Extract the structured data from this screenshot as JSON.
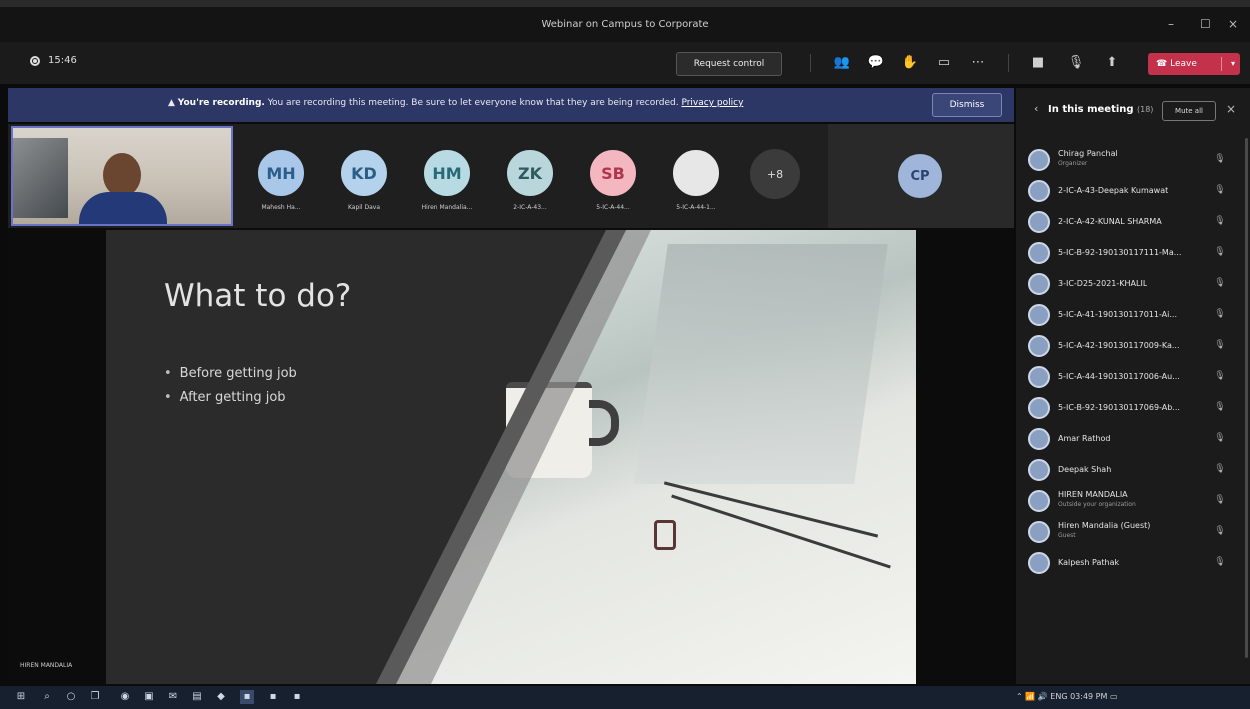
{
  "window": {
    "title": "Webinar on Campus to Corporate"
  },
  "toolbar": {
    "timer": "15:46",
    "request_control": "Request control",
    "leave": "Leave"
  },
  "banner": {
    "bold": "You're recording.",
    "text": "You are recording this meeting. Be sure to let everyone know that they are being recorded.",
    "link": "Privacy policy",
    "dismiss": "Dismiss"
  },
  "strip": {
    "tiles": [
      {
        "initials": "MH",
        "name": "Mahesh Ha...",
        "bg": "#a9c7e8",
        "fg": "#2d5d8c"
      },
      {
        "initials": "KD",
        "name": "Kapil Dava",
        "bg": "#b4d2ec",
        "fg": "#2b5e86"
      },
      {
        "initials": "HM",
        "name": "Hiren Mandalia...",
        "bg": "#b8dbe3",
        "fg": "#2a6a78"
      },
      {
        "initials": "ZK",
        "name": "2-IC-A-43...",
        "bg": "#b9d6db",
        "fg": "#2e5a60"
      },
      {
        "initials": "SB",
        "name": "5-IC-A-44...",
        "bg": "#f4b6bf",
        "fg": "#b0364b"
      },
      {
        "initials": "",
        "name": "5-IC-A-44-1...",
        "bg": "#e7e7e7",
        "fg": "#222"
      }
    ],
    "more": "+8",
    "cp": "CP"
  },
  "slide": {
    "title": "What to do?",
    "bullets": [
      "Before getting job",
      "After getting job"
    ],
    "presenter": "HIREN MANDALIA"
  },
  "panel": {
    "title": "In this meeting",
    "count": "(18)",
    "mute_all": "Mute all",
    "participants": [
      {
        "name": "Chirag Panchal",
        "role": "Organizer"
      },
      {
        "name": "2-IC-A-43-Deepak Kumawat",
        "role": ""
      },
      {
        "name": "2-IC-A-42-KUNAL SHARMA",
        "role": ""
      },
      {
        "name": "5-IC-B-92-190130117111-Ma...",
        "role": ""
      },
      {
        "name": "3-IC-D25-2021-KHALIL",
        "role": ""
      },
      {
        "name": "5-IC-A-41-190130117011-Ai...",
        "role": ""
      },
      {
        "name": "5-IC-A-42-190130117009-Ka...",
        "role": ""
      },
      {
        "name": "5-IC-A-44-190130117006-Au...",
        "role": ""
      },
      {
        "name": "5-IC-B-92-190130117069-Ab...",
        "role": ""
      },
      {
        "name": "Amar Rathod",
        "role": ""
      },
      {
        "name": "Deepak Shah",
        "role": ""
      },
      {
        "name": "HIREN MANDALIA",
        "role": "Outside your organization"
      },
      {
        "name": "Hiren Mandalia (Guest)",
        "role": "Guest"
      },
      {
        "name": "Kalpesh Pathak",
        "role": ""
      }
    ]
  },
  "tray": {
    "lang": "ENG",
    "time": "03:49 PM"
  }
}
